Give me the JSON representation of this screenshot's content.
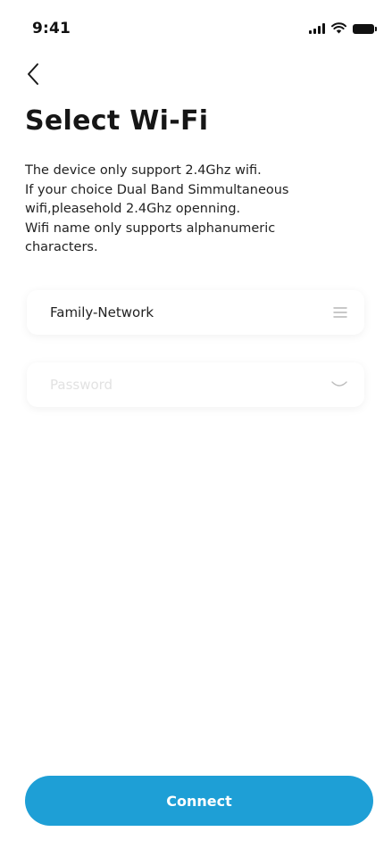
{
  "status_bar": {
    "time": "9:41",
    "icons": [
      "signal-icon",
      "wifi-icon",
      "battery-icon"
    ]
  },
  "nav": {
    "back_icon": "chevron-left-icon"
  },
  "title": "Select Wi-Fi",
  "description": [
    "The device only support 2.4Ghz wifi.",
    "If your choice Dual Band Simmultaneous",
    "wifi,pleasehold 2.4Ghz openning.",
    "Wifi name only supports alphanumeric",
    "characters."
  ],
  "form": {
    "wifi_name": {
      "value": "Family-Network",
      "icon": "list-icon"
    },
    "password": {
      "placeholder": "Password",
      "icon": "eye-closed-icon"
    }
  },
  "connect_label": "Connect",
  "colors": {
    "accent": "#1e9fd6",
    "text": "#161616",
    "background": "#ffffff"
  }
}
